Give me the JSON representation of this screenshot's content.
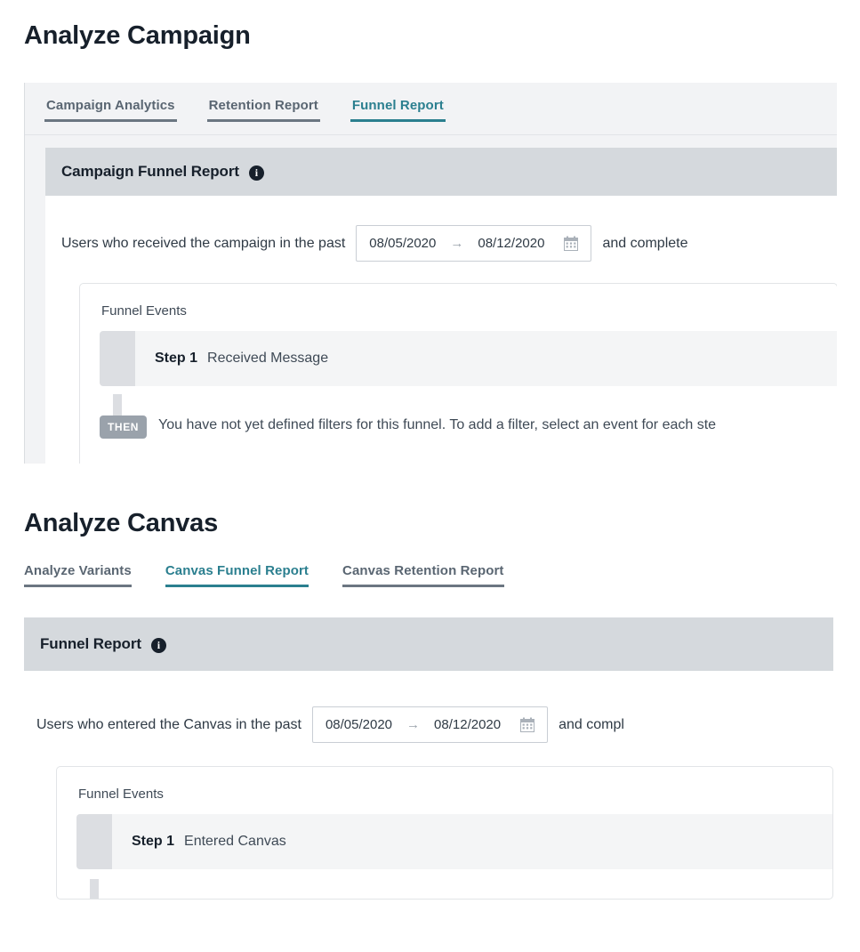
{
  "sections": [
    {
      "title": "Analyze Campaign",
      "tabs": [
        {
          "label": "Campaign Analytics",
          "active": false
        },
        {
          "label": "Retention Report",
          "active": false
        },
        {
          "label": "Funnel Report",
          "active": true
        }
      ],
      "card": {
        "header_title": "Campaign Funnel Report",
        "info_icon": "info-icon",
        "filter": {
          "lead_text": "Users who received the campaign in the past",
          "start_date": "08/05/2020",
          "range_arrow": "→",
          "end_date": "08/12/2020",
          "calendar_icon": "calendar-icon",
          "trailing_text": "and complete"
        },
        "funnel": {
          "legend": "Funnel Events",
          "steps": [
            {
              "label": "Step 1",
              "name": "Received Message"
            }
          ],
          "then_badge": "THEN",
          "then_text": "You have not yet defined filters for this funnel. To add a filter, select an event for each ste"
        }
      }
    },
    {
      "title": "Analyze Canvas",
      "tabs": [
        {
          "label": "Analyze Variants",
          "active": false
        },
        {
          "label": "Canvas Funnel Report",
          "active": true
        },
        {
          "label": "Canvas Retention Report",
          "active": false
        }
      ],
      "card": {
        "header_title": "Funnel Report",
        "info_icon": "info-icon",
        "filter": {
          "lead_text": "Users who entered the Canvas in the past",
          "start_date": "08/05/2020",
          "range_arrow": "→",
          "end_date": "08/12/2020",
          "calendar_icon": "calendar-icon",
          "trailing_text": "and compl"
        },
        "funnel": {
          "legend": "Funnel Events",
          "steps": [
            {
              "label": "Step 1",
              "name": "Entered Canvas"
            }
          ]
        }
      }
    }
  ],
  "colors": {
    "accent_teal": "#2b7f8f",
    "tab_inactive": "#5a6672",
    "card_header_bg": "#d5d9dd",
    "page_bg_gray": "#f2f3f5",
    "step_row_bg": "#f4f5f6",
    "step_handle": "#dcdee2",
    "text_dark": "#17202b"
  }
}
